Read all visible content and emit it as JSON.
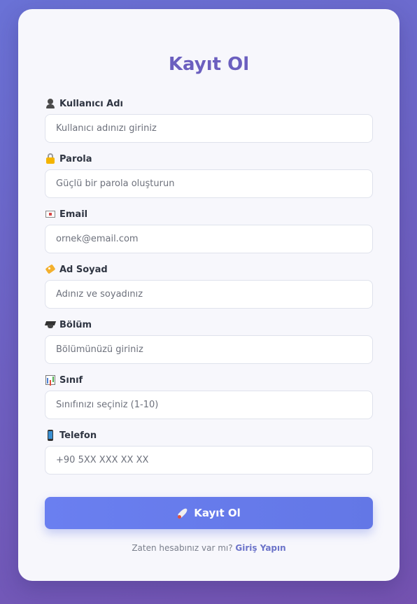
{
  "form": {
    "title": "Kayıt Ol",
    "fields": [
      {
        "label": "Kullanıcı Adı",
        "placeholder": "Kullanıcı adınızı giriniz",
        "value": "",
        "icon": "user-silhouette-icon"
      },
      {
        "label": "Parola",
        "placeholder": "Güçlü bir parola oluşturun",
        "value": "",
        "icon": "lock-icon"
      },
      {
        "label": "Email",
        "placeholder": "ornek@email.com",
        "value": "",
        "icon": "envelope-icon"
      },
      {
        "label": "Ad Soyad",
        "placeholder": "Adınız ve soyadınız",
        "value": "",
        "icon": "label-tag-icon"
      },
      {
        "label": "Bölüm",
        "placeholder": "Bölümünüzü giriniz",
        "value": "",
        "icon": "graduation-cap-icon"
      },
      {
        "label": "Sınıf",
        "placeholder": "Sınıfınızı seçiniz (1-10)",
        "value": "",
        "icon": "bar-chart-icon"
      },
      {
        "label": "Telefon",
        "placeholder": "+90 5XX XXX XX XX",
        "value": "",
        "icon": "mobile-phone-icon"
      }
    ],
    "submit_label": "Kayıt Ol",
    "submit_icon": "rocket-icon",
    "footer_text": "Zaten hesabınız var mı?",
    "login_link": "Giriş Yapın"
  },
  "colors": {
    "accent": "#6377e6",
    "title": "#6b5fbf",
    "link": "#6b73c9",
    "background_start": "#6a72d6",
    "background_end": "#7452b0"
  }
}
